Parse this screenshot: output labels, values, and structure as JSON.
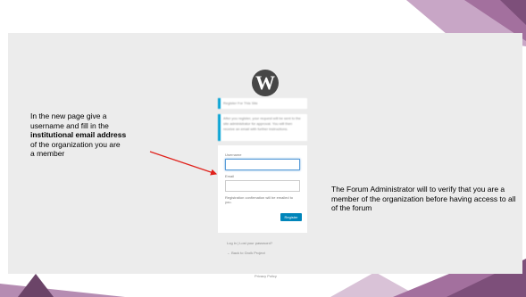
{
  "register_notice": "Register For This Site",
  "info_notice": "After you register, your request will be sent to the site administrator for approval. You will then receive an email with further instructions.",
  "form": {
    "username_label": "Username",
    "email_label": "Email",
    "confirmation_note": "Registration confirmation will be emailed to you.",
    "register_button": "Register"
  },
  "links": {
    "login_lost_password": "Log in | Lost your password?",
    "back_to_site": "← Back to Groik Project",
    "privacy_policy": "Privacy Policy"
  },
  "annotations": {
    "left_line1": "In the new page give a",
    "left_line2": "username and fill in the",
    "left_bold": "institutional email address",
    "left_line3": "of the organization you are",
    "left_line4": "a member",
    "right_text": "The Forum Administrator will to verify that you are a member of the organization before having access to all of the forum"
  },
  "colors": {
    "accent_purple": "#a3709e",
    "arrow_red": "#e0211b",
    "button_blue": "#0085ba"
  },
  "logo_icon": "wordpress-icon"
}
